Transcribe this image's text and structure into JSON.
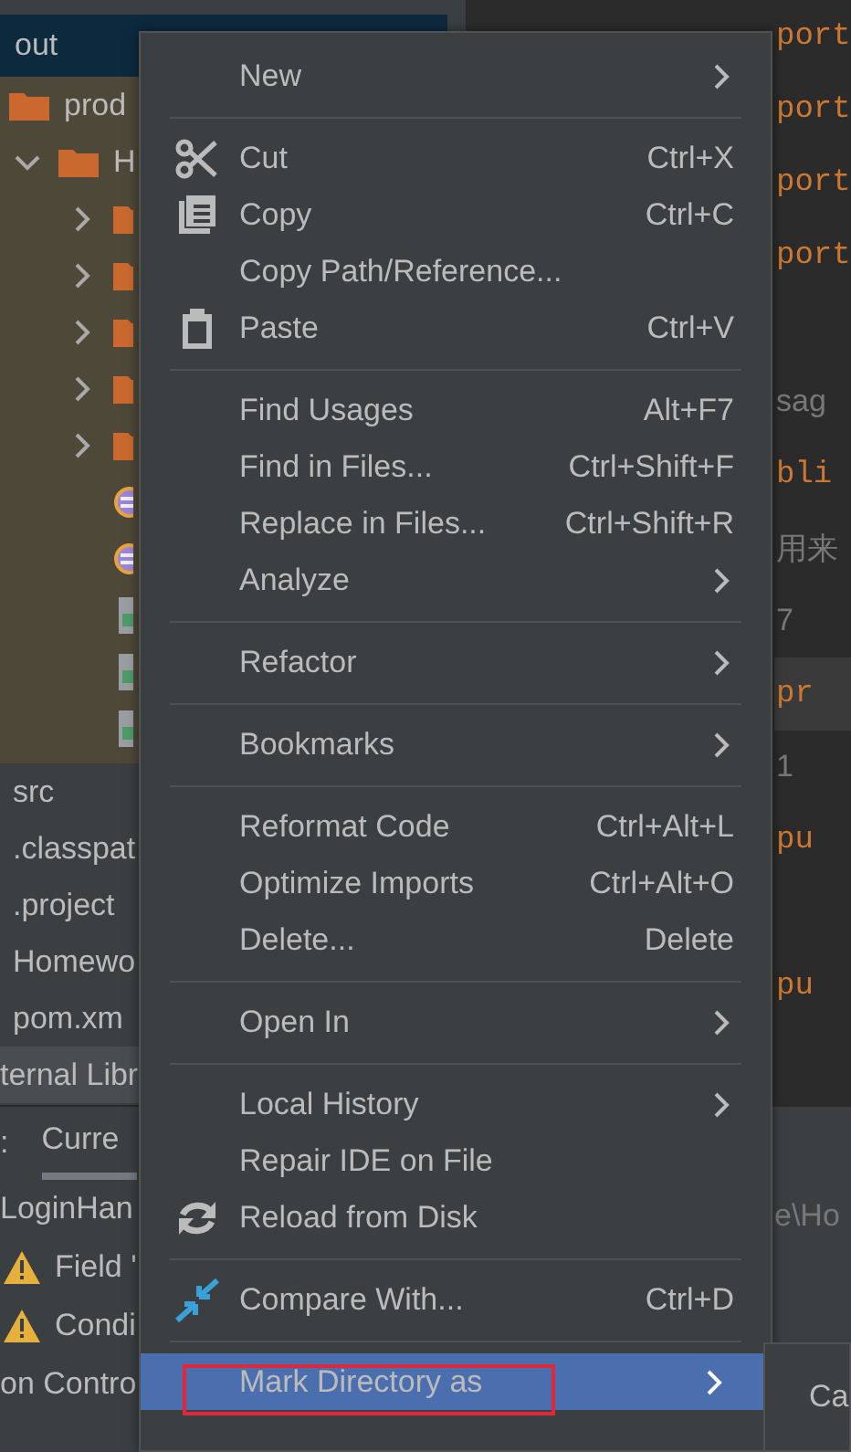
{
  "project": {
    "header": {
      "label": "out",
      "selected": true
    },
    "tree": [
      {
        "label": "prod",
        "kind": "folder"
      },
      {
        "label": "H",
        "kind": "folder",
        "expanded": true,
        "children": [
          {
            "kind": "folder",
            "expanded": false
          },
          {
            "kind": "folder",
            "expanded": false
          },
          {
            "kind": "folder",
            "expanded": false
          },
          {
            "kind": "folder",
            "expanded": false
          },
          {
            "kind": "folder",
            "expanded": false
          },
          {
            "kind": "class"
          },
          {
            "kind": "class"
          },
          {
            "kind": "file"
          },
          {
            "kind": "file"
          },
          {
            "kind": "file"
          }
        ]
      }
    ],
    "files": [
      {
        "label": "src"
      },
      {
        "label": ".classpat"
      },
      {
        "label": ".project"
      },
      {
        "label": "Homewo"
      },
      {
        "label": "pom.xm"
      },
      {
        "label": "ternal Libr"
      }
    ]
  },
  "editor": {
    "lines": [
      {
        "text": "port",
        "kind": "keyword",
        "current": false
      },
      {
        "text": "port",
        "kind": "keyword",
        "current": false
      },
      {
        "text": "port",
        "kind": "keyword",
        "current": false
      },
      {
        "text": "port",
        "kind": "keyword",
        "current": false
      },
      {
        "kind": "blank",
        "current": false
      },
      {
        "text": "sag",
        "kind": "hint",
        "current": false
      },
      {
        "text": "bli",
        "kind": "keyword",
        "current": false
      },
      {
        "text": "用来",
        "kind": "hint",
        "current": false
      },
      {
        "text": "7",
        "kind": "hint",
        "current": false
      },
      {
        "text": "pr",
        "kind": "keyword",
        "current": true
      },
      {
        "text": "1",
        "kind": "hint",
        "current": false
      },
      {
        "text": "pu",
        "kind": "keyword",
        "current": false
      },
      {
        "kind": "blank",
        "current": false
      },
      {
        "text": "pu",
        "kind": "keyword",
        "current": false
      }
    ]
  },
  "bottom_panel": {
    "title_fragment": ":",
    "tabs": [
      {
        "label": "Curre",
        "selected": true
      }
    ],
    "rows": [
      {
        "label": "LoginHan",
        "kind": "plain"
      },
      {
        "label": "Field '",
        "kind": "warning"
      },
      {
        "label": "Condi",
        "kind": "warning"
      }
    ],
    "status": "on Contro",
    "path_fragment": "e\\Ho"
  },
  "menu": {
    "items": [
      {
        "kind": "plain",
        "label": "New",
        "submenu": true,
        "selected": false
      },
      {
        "kind": "separator"
      },
      {
        "kind": "scissors",
        "label": "Cut",
        "shortcut": "Ctrl+X",
        "submenu": false,
        "selected": false
      },
      {
        "kind": "copy",
        "label": "Copy",
        "shortcut": "Ctrl+C",
        "submenu": false,
        "selected": false
      },
      {
        "kind": "plain",
        "label": "Copy Path/Reference...",
        "submenu": false,
        "selected": false
      },
      {
        "kind": "clipboard",
        "label": "Paste",
        "shortcut": "Ctrl+V",
        "submenu": false,
        "selected": false
      },
      {
        "kind": "separator"
      },
      {
        "kind": "plain",
        "label": "Find Usages",
        "shortcut": "Alt+F7",
        "submenu": false,
        "selected": false
      },
      {
        "kind": "plain",
        "label": "Find in Files...",
        "shortcut": "Ctrl+Shift+F",
        "submenu": false,
        "selected": false
      },
      {
        "kind": "plain",
        "label": "Replace in Files...",
        "shortcut": "Ctrl+Shift+R",
        "submenu": false,
        "selected": false
      },
      {
        "kind": "plain",
        "label": "Analyze",
        "submenu": true,
        "selected": false
      },
      {
        "kind": "separator"
      },
      {
        "kind": "plain",
        "label": "Refactor",
        "submenu": true,
        "selected": false
      },
      {
        "kind": "separator"
      },
      {
        "kind": "plain",
        "label": "Bookmarks",
        "submenu": true,
        "selected": false
      },
      {
        "kind": "separator"
      },
      {
        "kind": "plain",
        "label": "Reformat Code",
        "shortcut": "Ctrl+Alt+L",
        "submenu": false,
        "selected": false
      },
      {
        "kind": "plain",
        "label": "Optimize Imports",
        "shortcut": "Ctrl+Alt+O",
        "submenu": false,
        "selected": false
      },
      {
        "kind": "plain",
        "label": "Delete...",
        "shortcut": "Delete",
        "submenu": false,
        "selected": false
      },
      {
        "kind": "separator"
      },
      {
        "kind": "plain",
        "label": "Open In",
        "submenu": true,
        "selected": false
      },
      {
        "kind": "separator"
      },
      {
        "kind": "plain",
        "label": "Local History",
        "submenu": true,
        "selected": false
      },
      {
        "kind": "plain",
        "label": "Repair IDE on File",
        "submenu": false,
        "selected": false
      },
      {
        "kind": "reload",
        "label": "Reload from Disk",
        "submenu": false,
        "selected": false
      },
      {
        "kind": "separator"
      },
      {
        "kind": "compare",
        "label": "Compare With...",
        "shortcut": "Ctrl+D",
        "submenu": false,
        "selected": false
      },
      {
        "kind": "separator"
      },
      {
        "kind": "plain",
        "label": "Mark Directory as",
        "submenu": true,
        "selected": true,
        "outlined": true
      }
    ]
  },
  "submenu_peek": {
    "text": "Ca"
  }
}
